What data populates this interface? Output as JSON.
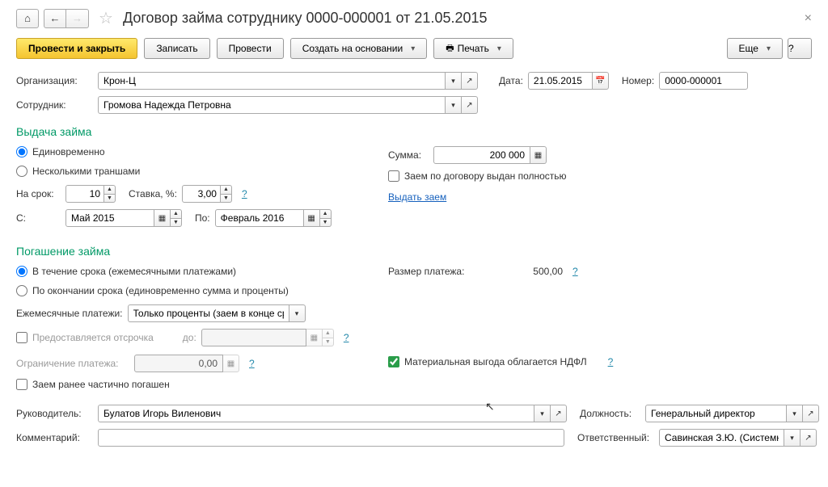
{
  "header": {
    "title": "Договор займа сотруднику 0000-000001 от 21.05.2015"
  },
  "toolbar": {
    "post_close": "Провести и закрыть",
    "write": "Записать",
    "post": "Провести",
    "create_based": "Создать на основании",
    "print": "Печать",
    "more": "Еще"
  },
  "fields": {
    "org_label": "Организация:",
    "org_value": "Крон-Ц",
    "date_label": "Дата:",
    "date_value": "21.05.2015",
    "number_label": "Номер:",
    "number_value": "0000-000001",
    "employee_label": "Сотрудник:",
    "employee_value": "Громова Надежда Петровна"
  },
  "loan_issue": {
    "title": "Выдача займа",
    "once": "Единовременно",
    "tranches": "Несколькими траншами",
    "term_label": "На срок:",
    "term_value": "10",
    "rate_label": "Ставка, %:",
    "rate_value": "3,00",
    "from_label": "С:",
    "from_value": "Май 2015",
    "to_label": "По:",
    "to_value": "Февраль 2016",
    "sum_label": "Сумма:",
    "sum_value": "200 000",
    "fully_issued": "Заем по договору выдан полностью",
    "issue_link": "Выдать заем"
  },
  "repayment": {
    "title": "Погашение займа",
    "during_term": "В течение срока (ежемесячными платежами)",
    "at_end": "По окончании срока (единовременно сумма и проценты)",
    "monthly_label": "Ежемесячные платежи:",
    "monthly_value": "Только проценты (заем в конце срока)",
    "deferment": "Предоставляется отсрочка",
    "deferment_until": "до:",
    "limit_label": "Ограничение платежа:",
    "limit_value": "0,00",
    "payment_size_label": "Размер платежа:",
    "payment_size_value": "500,00",
    "ndfl": "Материальная выгода облагается НДФЛ",
    "partially_repaid": "Заем ранее частично погашен"
  },
  "footer": {
    "manager_label": "Руководитель:",
    "manager_value": "Булатов Игорь Виленович",
    "position_label": "Должность:",
    "position_value": "Генеральный директор",
    "comment_label": "Комментарий:",
    "responsible_label": "Ответственный:",
    "responsible_value": "Савинская З.Ю. (Системный прог"
  }
}
